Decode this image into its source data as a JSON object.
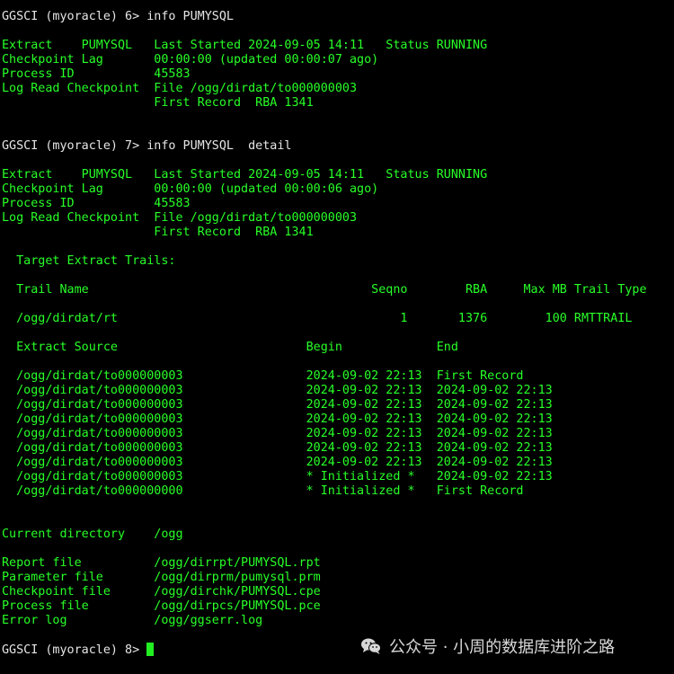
{
  "terminal": {
    "prompt_color": "#e6e6e6",
    "output_color": "#28ff28",
    "background": "#000000",
    "lines": [
      {
        "kind": "prompt",
        "text": "GGSCI (myoracle) 6> info PUMYSQL"
      },
      {
        "kind": "out",
        "text": ""
      },
      {
        "kind": "out",
        "text": "Extract    PUMYSQL   Last Started 2024-09-05 14:11   Status RUNNING"
      },
      {
        "kind": "out",
        "text": "Checkpoint Lag       00:00:00 (updated 00:00:07 ago)"
      },
      {
        "kind": "out",
        "text": "Process ID           45583"
      },
      {
        "kind": "out",
        "text": "Log Read Checkpoint  File /ogg/dirdat/to000000003"
      },
      {
        "kind": "out",
        "text": "                     First Record  RBA 1341"
      },
      {
        "kind": "out",
        "text": ""
      },
      {
        "kind": "out",
        "text": ""
      },
      {
        "kind": "prompt",
        "text": "GGSCI (myoracle) 7> info PUMYSQL  detail"
      },
      {
        "kind": "out",
        "text": ""
      },
      {
        "kind": "out",
        "text": "Extract    PUMYSQL   Last Started 2024-09-05 14:11   Status RUNNING"
      },
      {
        "kind": "out",
        "text": "Checkpoint Lag       00:00:00 (updated 00:00:06 ago)"
      },
      {
        "kind": "out",
        "text": "Process ID           45583"
      },
      {
        "kind": "out",
        "text": "Log Read Checkpoint  File /ogg/dirdat/to000000003"
      },
      {
        "kind": "out",
        "text": "                     First Record  RBA 1341"
      },
      {
        "kind": "out",
        "text": ""
      },
      {
        "kind": "out",
        "text": "  Target Extract Trails:"
      },
      {
        "kind": "out",
        "text": ""
      },
      {
        "kind": "out",
        "text": "  Trail Name                                       Seqno        RBA     Max MB Trail Type"
      },
      {
        "kind": "out",
        "text": ""
      },
      {
        "kind": "out",
        "text": "  /ogg/dirdat/rt                                       1       1376        100 RMTTRAIL"
      },
      {
        "kind": "out",
        "text": ""
      },
      {
        "kind": "out",
        "text": "  Extract Source                          Begin             End"
      },
      {
        "kind": "out",
        "text": ""
      },
      {
        "kind": "out",
        "text": "  /ogg/dirdat/to000000003                 2024-09-02 22:13  First Record"
      },
      {
        "kind": "out",
        "text": "  /ogg/dirdat/to000000003                 2024-09-02 22:13  2024-09-02 22:13"
      },
      {
        "kind": "out",
        "text": "  /ogg/dirdat/to000000003                 2024-09-02 22:13  2024-09-02 22:13"
      },
      {
        "kind": "out",
        "text": "  /ogg/dirdat/to000000003                 2024-09-02 22:13  2024-09-02 22:13"
      },
      {
        "kind": "out",
        "text": "  /ogg/dirdat/to000000003                 2024-09-02 22:13  2024-09-02 22:13"
      },
      {
        "kind": "out",
        "text": "  /ogg/dirdat/to000000003                 2024-09-02 22:13  2024-09-02 22:13"
      },
      {
        "kind": "out",
        "text": "  /ogg/dirdat/to000000003                 2024-09-02 22:13  2024-09-02 22:13"
      },
      {
        "kind": "out",
        "text": "  /ogg/dirdat/to000000003                 * Initialized *   2024-09-02 22:13"
      },
      {
        "kind": "out",
        "text": "  /ogg/dirdat/to000000000                 * Initialized *   First Record"
      },
      {
        "kind": "out",
        "text": ""
      },
      {
        "kind": "out",
        "text": ""
      },
      {
        "kind": "out",
        "text": "Current directory    /ogg"
      },
      {
        "kind": "out",
        "text": ""
      },
      {
        "kind": "out",
        "text": "Report file          /ogg/dirrpt/PUMYSQL.rpt"
      },
      {
        "kind": "out",
        "text": "Parameter file       /ogg/dirprm/pumysql.prm"
      },
      {
        "kind": "out",
        "text": "Checkpoint file      /ogg/dirchk/PUMYSQL.cpe"
      },
      {
        "kind": "out",
        "text": "Process file         /ogg/dirpcs/PUMYSQL.pce"
      },
      {
        "kind": "out",
        "text": "Error log            /ogg/ggserr.log"
      },
      {
        "kind": "out",
        "text": ""
      },
      {
        "kind": "prompt",
        "text": "GGSCI (myoracle) 8> "
      }
    ]
  },
  "watermark": {
    "icon": "wechat-icon",
    "text": "公众号 · 小周的数据库进阶之路"
  }
}
